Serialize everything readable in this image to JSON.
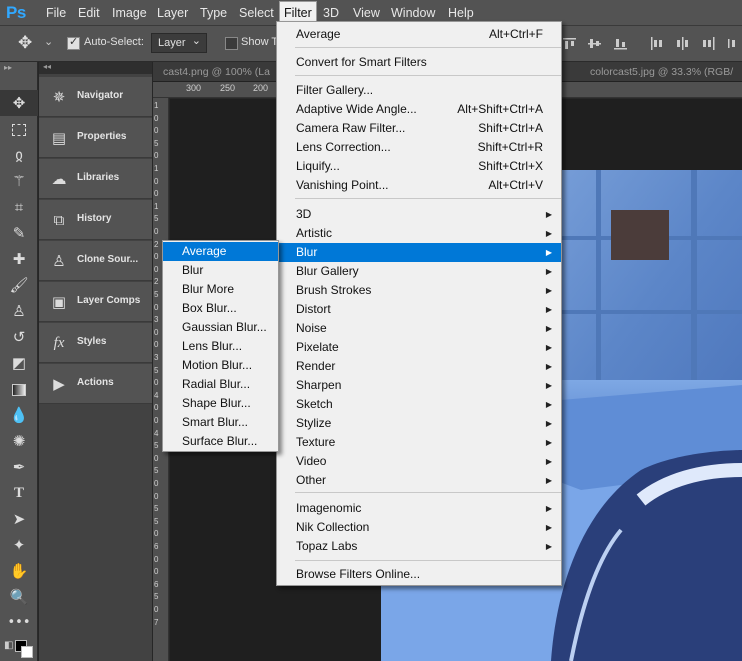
{
  "app": {
    "logo": "Ps"
  },
  "menubar": {
    "items": [
      "File",
      "Edit",
      "Image",
      "Layer",
      "Type",
      "Select",
      "Filter",
      "3D",
      "View",
      "Window",
      "Help"
    ],
    "active": "Filter"
  },
  "options": {
    "auto_select_label": "Auto-Select:",
    "auto_select_checked": true,
    "layer_select": "Layer",
    "show_transform_label": "Show Tr"
  },
  "tabs": [
    {
      "label": "cast4.png @ 100% (La"
    },
    {
      "label": "colorcast5.jpg @ 33.3% (RGB/"
    }
  ],
  "ruler": {
    "h": [
      "300",
      "250",
      "200"
    ],
    "v": [
      "1",
      "0",
      "0",
      "5",
      "0",
      "1",
      "0",
      "0",
      "1",
      "5",
      "0",
      "2",
      "0",
      "0",
      "2",
      "5",
      "0",
      "3",
      "0",
      "0",
      "3",
      "5",
      "0",
      "4",
      "0",
      "0",
      "4",
      "5",
      "0",
      "5",
      "0",
      "0",
      "5",
      "5",
      "0",
      "6",
      "0",
      "0",
      "6",
      "5",
      "0",
      "7"
    ]
  },
  "panels": [
    {
      "label": "Navigator",
      "icon": "navigator-icon"
    },
    {
      "label": "Properties",
      "icon": "properties-icon"
    },
    {
      "label": "Libraries",
      "icon": "libraries-icon"
    },
    {
      "label": "History",
      "icon": "history-icon"
    },
    {
      "label": "Clone Sour...",
      "icon": "clone-source-icon"
    },
    {
      "label": "Layer Comps",
      "icon": "layer-comps-icon"
    },
    {
      "label": "Styles",
      "icon": "styles-icon"
    },
    {
      "label": "Actions",
      "icon": "actions-icon"
    }
  ],
  "filter_menu": {
    "last_filter": {
      "label": "Average",
      "shortcut": "Alt+Ctrl+F"
    },
    "convert_smart": "Convert for Smart Filters",
    "group1": [
      {
        "label": "Filter Gallery...",
        "shortcut": ""
      },
      {
        "label": "Adaptive Wide Angle...",
        "shortcut": "Alt+Shift+Ctrl+A"
      },
      {
        "label": "Camera Raw Filter...",
        "shortcut": "Shift+Ctrl+A"
      },
      {
        "label": "Lens Correction...",
        "shortcut": "Shift+Ctrl+R"
      },
      {
        "label": "Liquify...",
        "shortcut": "Shift+Ctrl+X"
      },
      {
        "label": "Vanishing Point...",
        "shortcut": "Alt+Ctrl+V"
      }
    ],
    "submenus": [
      "3D",
      "Artistic",
      "Blur",
      "Blur Gallery",
      "Brush Strokes",
      "Distort",
      "Noise",
      "Pixelate",
      "Render",
      "Sharpen",
      "Sketch",
      "Stylize",
      "Texture",
      "Video",
      "Other"
    ],
    "highlighted": "Blur",
    "plugins": [
      "Imagenomic",
      "Nik Collection",
      "Topaz Labs"
    ],
    "browse": "Browse Filters Online..."
  },
  "blur_menu": {
    "items": [
      "Average",
      "Blur",
      "Blur More",
      "Box Blur...",
      "Gaussian Blur...",
      "Lens Blur...",
      "Motion Blur...",
      "Radial Blur...",
      "Shape Blur...",
      "Smart Blur...",
      "Surface Blur..."
    ],
    "highlighted": "Average"
  },
  "colors": {
    "accent": "#0078d7",
    "ps_blue": "#31a8ff",
    "ui_gray": "#535353"
  }
}
